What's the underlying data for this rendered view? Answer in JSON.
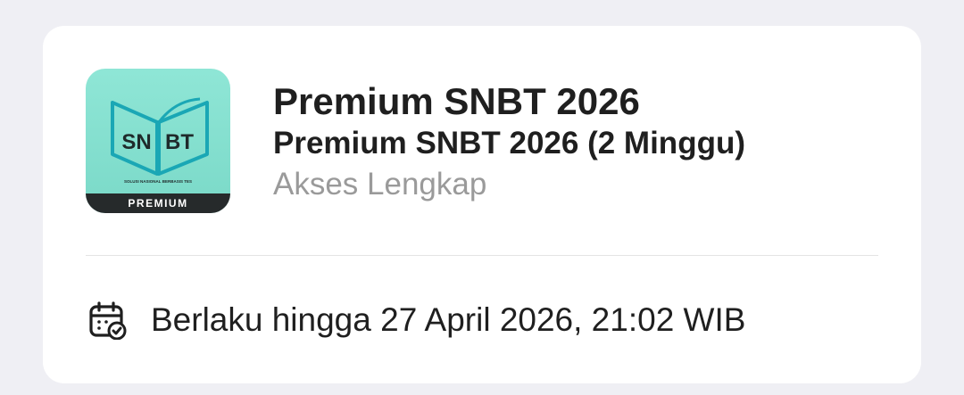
{
  "product": {
    "title": "Premium SNBT 2026",
    "subtitle": "Premium SNBT 2026 (2 Minggu)",
    "access": "Akses Lengkap",
    "thumbnail": {
      "logo_left": "SN",
      "logo_right": "BT",
      "tagline": "SOLUSI NASIONAL BERBASIS TES",
      "badge": "PREMIUM",
      "bg_color": "#8fe6d6",
      "accent_color": "#1aa7b5"
    }
  },
  "validity": {
    "icon": "calendar-check-icon",
    "text": "Berlaku hingga 27 April 2026, 21:02 WIB"
  }
}
